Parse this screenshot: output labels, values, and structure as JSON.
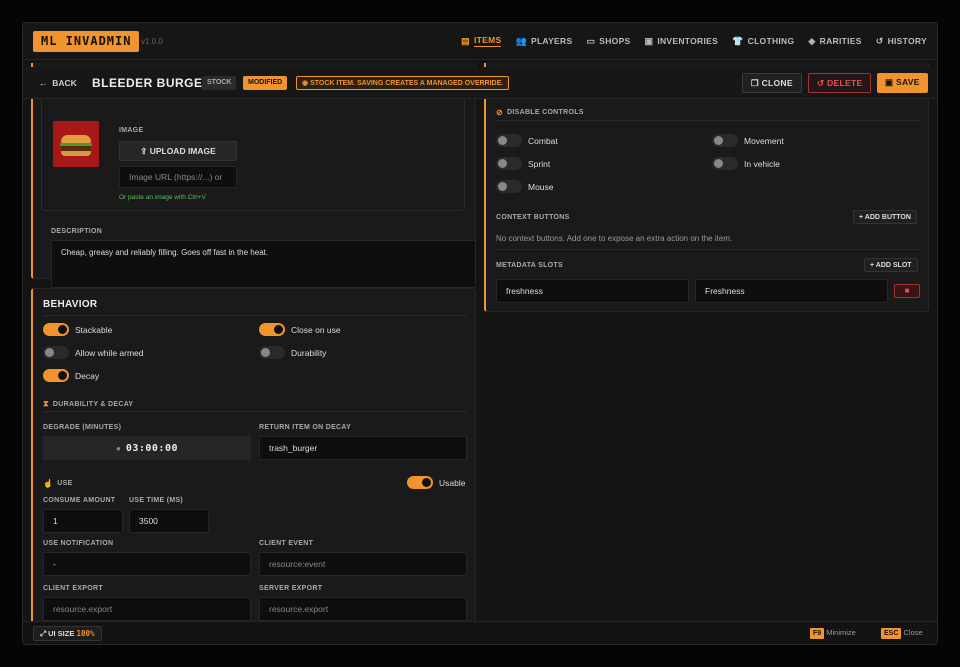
{
  "app": {
    "logo": "ML INVADMIN",
    "version": "v1.0.0"
  },
  "nav": [
    {
      "icon": "▤",
      "label": "ITEMS",
      "active": true
    },
    {
      "icon": "👥",
      "label": "PLAYERS"
    },
    {
      "icon": "▭",
      "label": "SHOPS"
    },
    {
      "icon": "▣",
      "label": "INVENTORIES"
    },
    {
      "icon": "👕",
      "label": "CLOTHING"
    },
    {
      "icon": "◈",
      "label": "RARITIES"
    },
    {
      "icon": "↺",
      "label": "HISTORY"
    }
  ],
  "header": {
    "back": "BACK",
    "title": "BLEEDER BURGER",
    "stock_badge": "STOCK",
    "modified_badge": "MODIFIED",
    "warning": "STOCK ITEM. SAVING CREATES A MANAGED OVERRIDE.",
    "clone": "CLONE",
    "delete": "DELETE",
    "save": "SAVE"
  },
  "image": {
    "label": "IMAGE",
    "upload": "UPLOAD IMAGE",
    "url_placeholder": "Image URL (https://...) or",
    "hint": "Or paste an image with Ctrl+V"
  },
  "description": {
    "label": "DESCRIPTION",
    "value": "Cheap, greasy and reliably filling. Goes off fast in the heat."
  },
  "behavior": {
    "title": "BEHAVIOR",
    "toggles": [
      {
        "label": "Stackable",
        "on": true
      },
      {
        "label": "Close on use",
        "on": true
      },
      {
        "label": "Allow while armed",
        "on": false
      },
      {
        "label": "Durability",
        "on": false
      },
      {
        "label": "Decay",
        "on": true
      }
    ]
  },
  "decay": {
    "title": "DURABILITY & DECAY",
    "degrade_label": "DEGRADE (MINUTES)",
    "degrade_value": "03:00:00",
    "return_label": "RETURN ITEM ON DECAY",
    "return_value": "trash_burger"
  },
  "use": {
    "title": "USE",
    "usable_label": "Usable",
    "usable_on": true,
    "consume_label": "CONSUME AMOUNT",
    "consume_value": "1",
    "time_label": "USE TIME (MS)",
    "time_value": "3500",
    "notif_label": "USE NOTIFICATION",
    "notif_value": "-",
    "client_event_label": "CLIENT EVENT",
    "client_event_ph": "resource:event",
    "client_export_label": "CLIENT EXPORT",
    "client_export_ph": "resource.export",
    "server_export_label": "SERVER EXPORT",
    "server_export_ph": "resource.export"
  },
  "disable": {
    "title": "DISABLE CONTROLS",
    "toggles": [
      {
        "label": "Combat",
        "on": false
      },
      {
        "label": "Movement",
        "on": false
      },
      {
        "label": "Sprint",
        "on": false
      },
      {
        "label": "In vehicle",
        "on": false
      },
      {
        "label": "Mouse",
        "on": false
      }
    ]
  },
  "context": {
    "title": "CONTEXT BUTTONS",
    "add": "ADD BUTTON",
    "empty": "No context buttons. Add one to expose an extra action on the item."
  },
  "metadata": {
    "title": "METADATA SLOTS",
    "add": "ADD SLOT",
    "key": "freshness",
    "label": "Freshness"
  },
  "footer": {
    "ui_size": "UI SIZE",
    "ui_pct": "100%",
    "f9": "F9",
    "minimize": "Minimize",
    "esc": "ESC",
    "close": "Close"
  },
  "colors": {
    "accent": "#f0942f",
    "danger": "#e05050"
  }
}
